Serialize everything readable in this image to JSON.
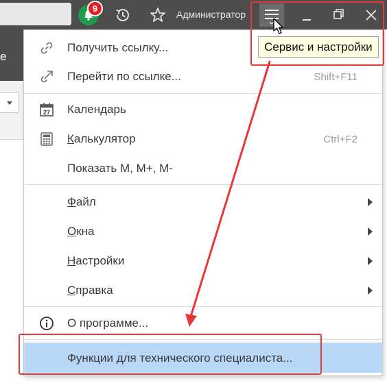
{
  "titlebar": {
    "notifications_count": "9",
    "user_name": "Администратор",
    "bell_color": "#1f9a4c",
    "badge_color": "#e31e24"
  },
  "background": {
    "partial_letter": "е"
  },
  "menu": {
    "items": [
      {
        "label": "Получить ссылку...",
        "shortcut": "",
        "icon": "link-icon"
      },
      {
        "label": "Перейти по ссылке...",
        "shortcut": "Shift+F11",
        "icon": "goto-link-icon"
      },
      {
        "label": "Календарь",
        "shortcut": "",
        "icon": "calendar-icon",
        "calendar_day": "27"
      },
      {
        "label_mnemonic": "К",
        "label_rest": "алькулятор",
        "shortcut": "Ctrl+F2",
        "icon": "calculator-icon"
      },
      {
        "label": "Показать М, М+, М-",
        "shortcut": ""
      },
      {
        "label_mnemonic": "Ф",
        "label_rest": "айл",
        "submenu": true
      },
      {
        "label_mnemonic": "О",
        "label_rest": "кна",
        "submenu": true
      },
      {
        "label_mnemonic": "Н",
        "label_rest": "астройки",
        "submenu": true
      },
      {
        "label_mnemonic": "С",
        "label_rest": "правка",
        "submenu": true
      },
      {
        "label": "О программе...",
        "icon": "info-icon"
      },
      {
        "label": "Функции для технического специалиста...",
        "highlighted": true
      }
    ]
  },
  "tooltip": {
    "text": "Сервис и настройки"
  },
  "colors": {
    "highlight": "#b9d7f7",
    "annotation": "#e53935",
    "titlebar": "#4d4d4d"
  }
}
